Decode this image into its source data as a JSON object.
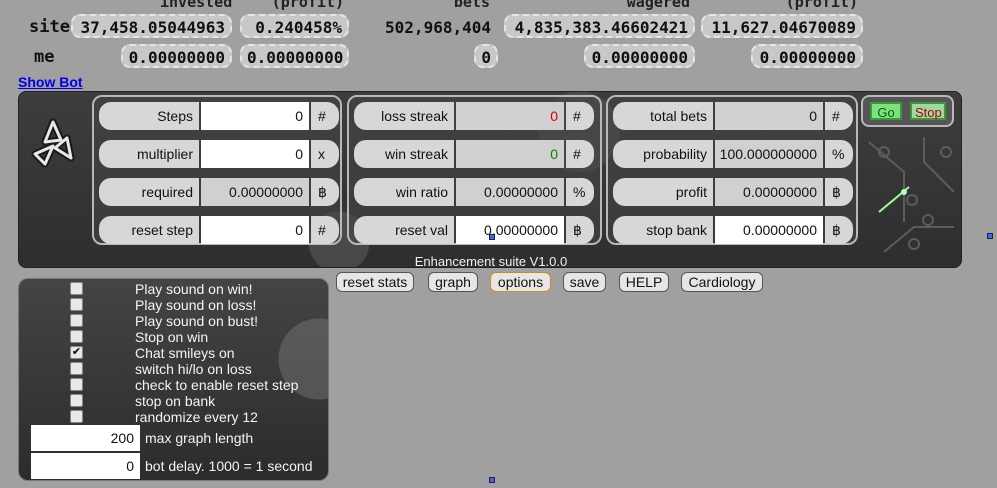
{
  "stats": {
    "headers": [
      "invested",
      "(profit)",
      "bets",
      "wagered",
      "(profit)"
    ],
    "site": {
      "label": "site",
      "invested": "37,458.05044963",
      "profit": "0.240458%",
      "bets": "502,968,404",
      "wagered": "4,835,383.46602421",
      "wagered_profit": "11,627.04670089"
    },
    "me": {
      "label": "me",
      "invested": "0.00000000",
      "profit": "0.00000000",
      "bets": "0",
      "wagered": "0.00000000",
      "wagered_profit": "0.00000000"
    }
  },
  "show_bot": "Show Bot",
  "panel": {
    "col1": [
      {
        "label": "Steps",
        "value": "0",
        "unit": "#"
      },
      {
        "label": "multiplier",
        "value": "0",
        "unit": "x"
      },
      {
        "label": "required",
        "value": "0.00000000",
        "unit": "฿"
      },
      {
        "label": "reset step",
        "value": "0",
        "unit": "#"
      }
    ],
    "col2": [
      {
        "label": "loss streak",
        "value": "0",
        "unit": "#"
      },
      {
        "label": "win streak",
        "value": "0",
        "unit": "#"
      },
      {
        "label": "win ratio",
        "value": "0.00000000",
        "unit": "%"
      },
      {
        "label": "reset val",
        "value": "0.00000000",
        "unit": "฿"
      }
    ],
    "col3": [
      {
        "label": "total bets",
        "value": "0",
        "unit": "#"
      },
      {
        "label": "probability",
        "value": "100.000000000",
        "unit": "%"
      },
      {
        "label": "profit",
        "value": "0.00000000",
        "unit": "฿"
      },
      {
        "label": "stop bank",
        "value": "0.00000000",
        "unit": "฿"
      }
    ],
    "go": "Go",
    "stop": "Stop",
    "version": "Enhancement suite V1.0.0",
    "colors": {
      "loss_streak": "#dd0000",
      "win_streak": "#008800"
    }
  },
  "buttons": [
    "reset stats",
    "graph",
    "options",
    "save",
    "HELP",
    "Cardiology"
  ],
  "options": {
    "checkboxes": [
      {
        "label": "Play sound on win!",
        "checked": false
      },
      {
        "label": "Play sound on loss!",
        "checked": false
      },
      {
        "label": "Play sound on bust!",
        "checked": false
      },
      {
        "label": "Stop on win",
        "checked": false
      },
      {
        "label": "Chat smileys on",
        "checked": true
      },
      {
        "label": "switch hi/lo on loss",
        "checked": false
      },
      {
        "label": "check to enable reset step",
        "checked": false
      },
      {
        "label": "stop on bank",
        "checked": false
      },
      {
        "label": "randomize every 12",
        "checked": false
      }
    ],
    "max_graph": {
      "value": "200",
      "label": "max graph length"
    },
    "bot_delay": {
      "value": "0",
      "label": "bot delay. 1000 = 1 second"
    }
  }
}
